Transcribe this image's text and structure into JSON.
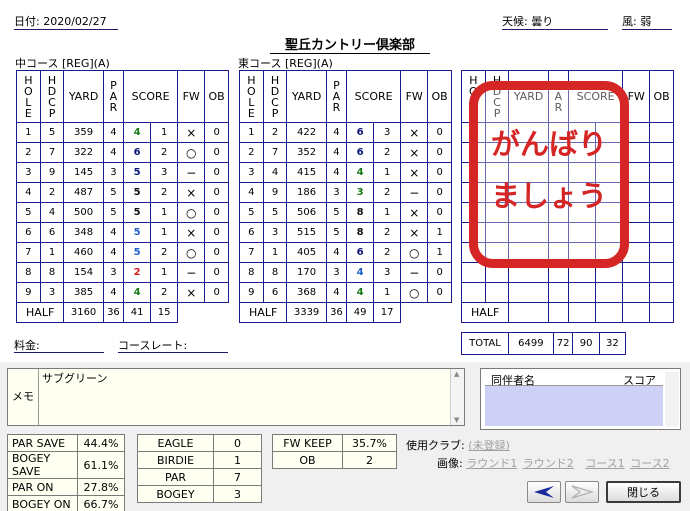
{
  "header": {
    "date_label": "日付: 2020/02/27",
    "weather_label": "天候: 曇り",
    "wind_label": "風: 弱",
    "title": "聖丘カントリー倶楽部"
  },
  "courses": [
    {
      "name": "中コース [REG](A)",
      "headers": {
        "hole": "HOLE",
        "hdcp": "HDCP",
        "yard": "YARD",
        "par": "PAR",
        "score": "SCORE",
        "fw": "FW",
        "ob": "OB"
      },
      "rows": [
        {
          "hole": "1",
          "hdcp": "5",
          "yard": "359",
          "par": "4",
          "score": "4",
          "putt": "1",
          "fw": "×",
          "ob": "0",
          "color": "#1a7a1a"
        },
        {
          "hole": "2",
          "hdcp": "7",
          "yard": "322",
          "par": "4",
          "score": "6",
          "putt": "2",
          "fw": "○",
          "ob": "0",
          "color": "#0a1478"
        },
        {
          "hole": "3",
          "hdcp": "9",
          "yard": "145",
          "par": "3",
          "score": "5",
          "putt": "3",
          "fw": "−",
          "ob": "0",
          "color": "#0a1478"
        },
        {
          "hole": "4",
          "hdcp": "2",
          "yard": "487",
          "par": "5",
          "score": "5",
          "putt": "2",
          "fw": "×",
          "ob": "0",
          "color": "#111111"
        },
        {
          "hole": "5",
          "hdcp": "4",
          "yard": "500",
          "par": "5",
          "score": "5",
          "putt": "1",
          "fw": "○",
          "ob": "0",
          "color": "#111111"
        },
        {
          "hole": "6",
          "hdcp": "6",
          "yard": "348",
          "par": "4",
          "score": "5",
          "putt": "1",
          "fw": "×",
          "ob": "0",
          "color": "#1e5fc8"
        },
        {
          "hole": "7",
          "hdcp": "1",
          "yard": "460",
          "par": "4",
          "score": "5",
          "putt": "2",
          "fw": "○",
          "ob": "0",
          "color": "#1e5fc8"
        },
        {
          "hole": "8",
          "hdcp": "8",
          "yard": "154",
          "par": "3",
          "score": "2",
          "putt": "1",
          "fw": "−",
          "ob": "0",
          "color": "#d81e1e"
        },
        {
          "hole": "9",
          "hdcp": "3",
          "yard": "385",
          "par": "4",
          "score": "4",
          "putt": "2",
          "fw": "×",
          "ob": "0",
          "color": "#1a7a1a"
        }
      ],
      "half": {
        "label": "HALF",
        "yard": "3160",
        "par": "36",
        "score": "41",
        "putt": "15"
      }
    },
    {
      "name": "東コース [REG](A)",
      "headers": {
        "hole": "HOLE",
        "hdcp": "HDCP",
        "yard": "YARD",
        "par": "PAR",
        "score": "SCORE",
        "fw": "FW",
        "ob": "OB"
      },
      "rows": [
        {
          "hole": "1",
          "hdcp": "2",
          "yard": "422",
          "par": "4",
          "score": "6",
          "putt": "3",
          "fw": "×",
          "ob": "0",
          "color": "#0a1478"
        },
        {
          "hole": "2",
          "hdcp": "7",
          "yard": "352",
          "par": "4",
          "score": "6",
          "putt": "2",
          "fw": "×",
          "ob": "0",
          "color": "#0a1478"
        },
        {
          "hole": "3",
          "hdcp": "4",
          "yard": "415",
          "par": "4",
          "score": "4",
          "putt": "1",
          "fw": "×",
          "ob": "0",
          "color": "#1a7a1a"
        },
        {
          "hole": "4",
          "hdcp": "9",
          "yard": "186",
          "par": "3",
          "score": "3",
          "putt": "2",
          "fw": "−",
          "ob": "0",
          "color": "#1a7a1a"
        },
        {
          "hole": "5",
          "hdcp": "5",
          "yard": "506",
          "par": "5",
          "score": "8",
          "putt": "1",
          "fw": "×",
          "ob": "0",
          "color": "#111111"
        },
        {
          "hole": "6",
          "hdcp": "3",
          "yard": "515",
          "par": "5",
          "score": "8",
          "putt": "2",
          "fw": "×",
          "ob": "1",
          "color": "#111111"
        },
        {
          "hole": "7",
          "hdcp": "1",
          "yard": "405",
          "par": "4",
          "score": "6",
          "putt": "2",
          "fw": "○",
          "ob": "1",
          "color": "#0a1478"
        },
        {
          "hole": "8",
          "hdcp": "8",
          "yard": "170",
          "par": "3",
          "score": "4",
          "putt": "3",
          "fw": "−",
          "ob": "0",
          "color": "#1e5fc8"
        },
        {
          "hole": "9",
          "hdcp": "6",
          "yard": "368",
          "par": "4",
          "score": "4",
          "putt": "1",
          "fw": "○",
          "ob": "0",
          "color": "#1a7a1a"
        }
      ],
      "half": {
        "label": "HALF",
        "yard": "3339",
        "par": "36",
        "score": "49",
        "putt": "17"
      }
    }
  ],
  "third": {
    "headers": {
      "hole": "HOLE",
      "hdcp": "HDCP",
      "yard": "YARD",
      "par": "PAR",
      "score": "SCORE",
      "fw": "FW",
      "ob": "OB"
    },
    "half_label": "HALF",
    "total": {
      "label": "TOTAL",
      "yard": "6499",
      "par": "72",
      "score": "90",
      "putt": "32"
    }
  },
  "stamp_lines": [
    "がんばり",
    "ましょう"
  ],
  "fee_label": "料金:",
  "course_rate_label": "コースレート:",
  "memo": {
    "label": "メモ",
    "text": "サブグリーン"
  },
  "companions": {
    "name_header": "同伴者名",
    "score_header": "スコア"
  },
  "stats_left": [
    {
      "label": "PAR SAVE",
      "value": "44.4%"
    },
    {
      "label": "BOGEY SAVE",
      "value": "61.1%"
    },
    {
      "label": "PAR ON",
      "value": "27.8%"
    },
    {
      "label": "BOGEY ON",
      "value": "66.7%"
    }
  ],
  "stats_mid": [
    {
      "label": "EAGLE",
      "value": "0"
    },
    {
      "label": "BIRDIE",
      "value": "1"
    },
    {
      "label": "PAR",
      "value": "7"
    },
    {
      "label": "BOGEY",
      "value": "3"
    }
  ],
  "stats_right": [
    {
      "label": "FW KEEP",
      "value": "35.7%"
    },
    {
      "label": "OB",
      "value": "2"
    }
  ],
  "clubs": {
    "label": "使用クラブ:",
    "value": "(未登録)"
  },
  "images": {
    "label": "画像:",
    "links": [
      "ラウンド1",
      "ラウンド2",
      "コース1",
      "コース2"
    ]
  },
  "buttons": {
    "close": "閉じる"
  },
  "colors": {
    "grid": "#1a1a8a",
    "stamp": "#d52525",
    "companion_body": "#cfd0f5"
  }
}
